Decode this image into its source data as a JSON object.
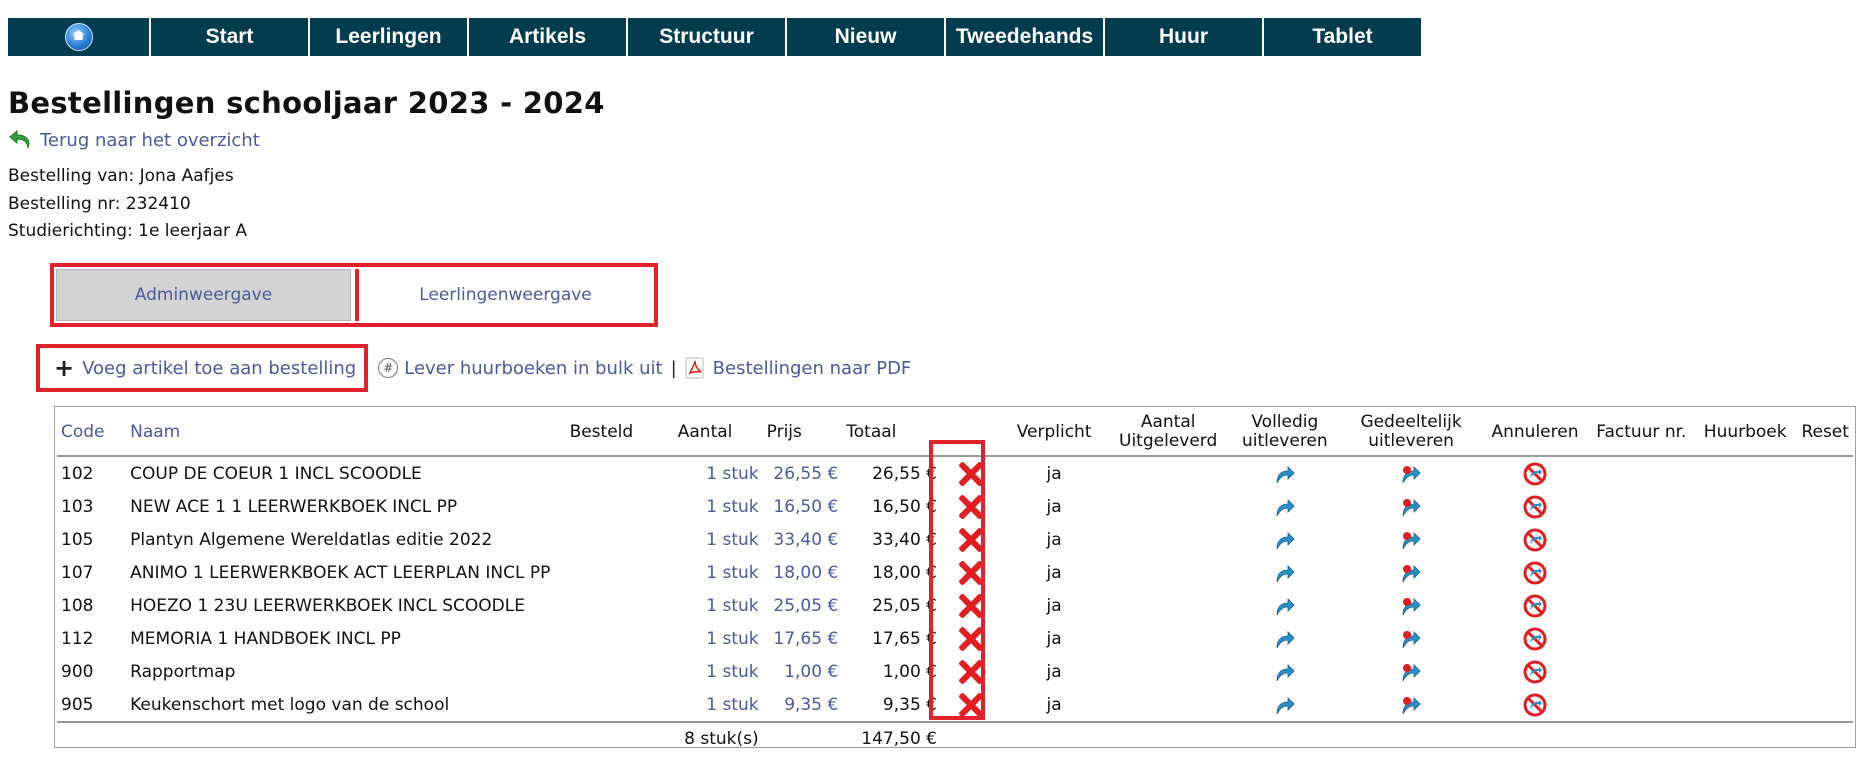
{
  "nav": {
    "items": [
      "Start",
      "Leerlingen",
      "Artikels",
      "Structuur",
      "Nieuw",
      "Tweedehands",
      "Huur",
      "Tablet"
    ]
  },
  "page": {
    "title": "Bestellingen schooljaar 2023 - 2024",
    "back_link": "Terug naar het overzicht",
    "order_by": "Bestelling van: Jona Aafjes",
    "order_nr": "Bestelling nr: 232410",
    "study": "Studierichting: 1e leerjaar A"
  },
  "tabs": {
    "admin": "Adminweergave",
    "student": "Leerlingenweergave"
  },
  "actions": {
    "add": "Voeg artikel toe aan bestelling",
    "bulk": "Lever huurboeken in bulk uit",
    "separator": "|",
    "pdf": "Bestellingen naar PDF"
  },
  "table": {
    "headers": {
      "code": "Code",
      "naam": "Naam",
      "besteld": "Besteld",
      "aantal": "Aantal",
      "prijs": "Prijs",
      "totaal": "Totaal",
      "verplicht": "Verplicht",
      "aantal_uitgeleverd_1": "Aantal",
      "aantal_uitgeleverd_2": "Uitgeleverd",
      "volledig_1": "Volledig",
      "volledig_2": "uitleveren",
      "gedeeltelijk_1": "Gedeeltelijk",
      "gedeeltelijk_2": "uitleveren",
      "annuleren": "Annuleren",
      "factuur": "Factuur nr.",
      "huurboek": "Huurboek",
      "reset": "Reset"
    },
    "rows": [
      {
        "code": "102",
        "naam": "COUP DE COEUR 1 INCL SCOODLE",
        "aantal": "1 stuk",
        "prijs": "26,55 €",
        "totaal": "26,55 €",
        "verplicht": "ja"
      },
      {
        "code": "103",
        "naam": "NEW ACE 1 1 LEERWERKBOEK INCL PP",
        "aantal": "1 stuk",
        "prijs": "16,50 €",
        "totaal": "16,50 €",
        "verplicht": "ja"
      },
      {
        "code": "105",
        "naam": "Plantyn Algemene Wereldatlas editie 2022",
        "aantal": "1 stuk",
        "prijs": "33,40 €",
        "totaal": "33,40 €",
        "verplicht": "ja"
      },
      {
        "code": "107",
        "naam": "ANIMO 1 LEERWERKBOEK ACT LEERPLAN INCL PP",
        "aantal": "1 stuk",
        "prijs": "18,00 €",
        "totaal": "18,00 €",
        "verplicht": "ja"
      },
      {
        "code": "108",
        "naam": "HOEZO 1 23U LEERWERKBOEK INCL SCOODLE",
        "aantal": "1 stuk",
        "prijs": "25,05 €",
        "totaal": "25,05 €",
        "verplicht": "ja"
      },
      {
        "code": "112",
        "naam": "MEMORIA 1 HANDBOEK INCL PP",
        "aantal": "1 stuk",
        "prijs": "17,65 €",
        "totaal": "17,65 €",
        "verplicht": "ja"
      },
      {
        "code": "900",
        "naam": "Rapportmap",
        "aantal": "1 stuk",
        "prijs": "1,00 €",
        "totaal": "1,00 €",
        "verplicht": "ja"
      },
      {
        "code": "905",
        "naam": "Keukenschort met logo van de school",
        "aantal": "1 stuk",
        "prijs": "9,35 €",
        "totaal": "9,35 €",
        "verplicht": "ja"
      }
    ],
    "footer": {
      "aantal": "8 stuk(s)",
      "totaal": "147,50 €"
    }
  },
  "icons": {
    "home": "home-icon",
    "back": "undo-arrow-icon",
    "add": "plus-icon",
    "bulk": "hash-icon",
    "pdf": "pdf-icon",
    "delete": "delete-x-icon",
    "full": "share-arrow-icon",
    "partial": "partial-share-icon",
    "cancel": "cancel-icon"
  },
  "colors": {
    "nav_bg": "#043c4f",
    "link": "#4a5a9a",
    "highlight": "#e3212b",
    "delete": "#e11d22"
  }
}
